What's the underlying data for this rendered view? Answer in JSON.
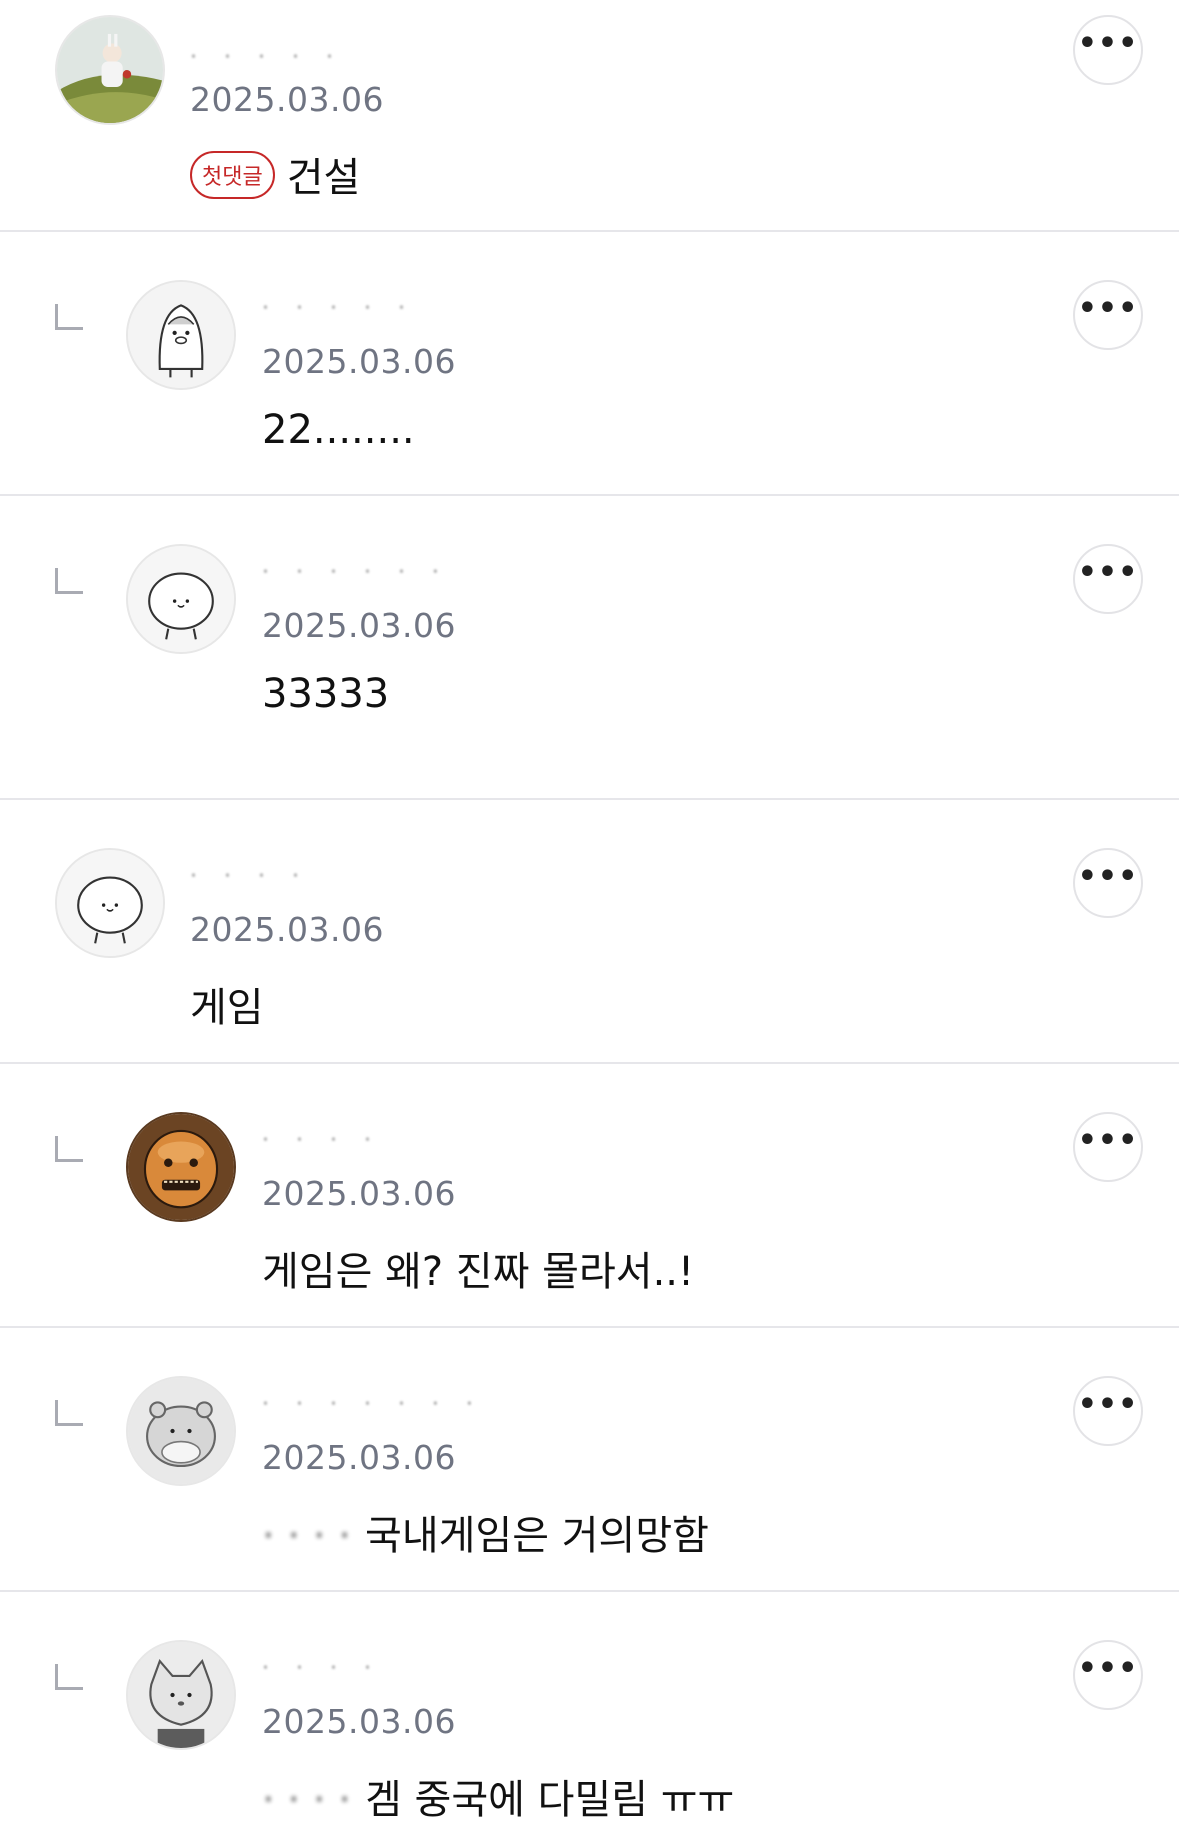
{
  "comments": [
    {
      "nickname": "· · · · ·",
      "date": "2025.03.06",
      "badge": "첫댓글",
      "text": "건설",
      "avatar_icon": "avatar-photo-icon",
      "more_icon": "more-options-icon"
    },
    {
      "nickname": "· · · · ·",
      "date": "2025.03.06",
      "text": "22........",
      "avatar_icon": "penguin-character-icon"
    },
    {
      "nickname": "· · · · · ·",
      "date": "2025.03.06",
      "text": "33333",
      "avatar_icon": "white-cat-character-icon"
    },
    {
      "nickname": "· · · ·",
      "date": "2025.03.06",
      "text": "게임",
      "avatar_icon": "white-cat-character-icon"
    },
    {
      "nickname": "· · · ·",
      "date": "2025.03.06",
      "text": "게임은 왜? 진짜 몰라서..!",
      "avatar_icon": "monkey-face-icon"
    },
    {
      "nickname": "· · · · · · ·",
      "date": "2025.03.06",
      "text_blurred": "· · · ·",
      "text": "국내게임은 거의망함",
      "avatar_icon": "hamster-character-icon"
    },
    {
      "nickname": "· · · ·",
      "date": "2025.03.06",
      "text_blurred": "· · · ·",
      "text": "겜 중국에 다밀림 ㅠㅠ",
      "avatar_icon": "cat-character-icon"
    }
  ],
  "colors": {
    "badge": "#c62828",
    "date": "#6f7482",
    "divider": "#e6e6ea"
  }
}
